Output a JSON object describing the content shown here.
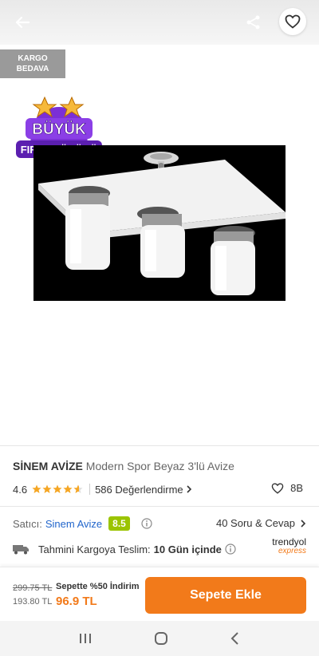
{
  "header": {
    "back_icon": "back-arrow-icon",
    "share_icon": "share-icon",
    "favorite_icon": "heart-icon"
  },
  "badges": {
    "shipping_line1": "KARGO",
    "shipping_line2": "BEDAVA",
    "promo_line1": "BÜYÜK",
    "promo_line2": "FIRSAT ÜRÜNÜ"
  },
  "product": {
    "brand": "SİNEM AVİZE",
    "name": "Modern Spor Beyaz 3'lü Avize",
    "rating": "4.6",
    "rating_value": 4.6,
    "reviews_label": "586 Değerlendirme",
    "favorites_count": "8B"
  },
  "seller": {
    "label": "Satıcı:",
    "name": "Sinem Avize",
    "score": "8.5",
    "qa_label": "40 Soru & Cevap"
  },
  "delivery": {
    "label": "Tahmini Kargoya Teslim:",
    "value": "10 Gün içinde",
    "brand_line1": "trendyol",
    "brand_line2": "express"
  },
  "pricing": {
    "old_price": "299.75 TL",
    "sub_price": "193.80 TL",
    "campaign": "Sepette %50 İndirim",
    "final_price": "96.9 TL",
    "add_to_cart_label": "Sepete Ekle"
  },
  "colors": {
    "accent": "#f27a1a",
    "seller_score_bg": "#9bc400",
    "link": "#2266cc"
  }
}
